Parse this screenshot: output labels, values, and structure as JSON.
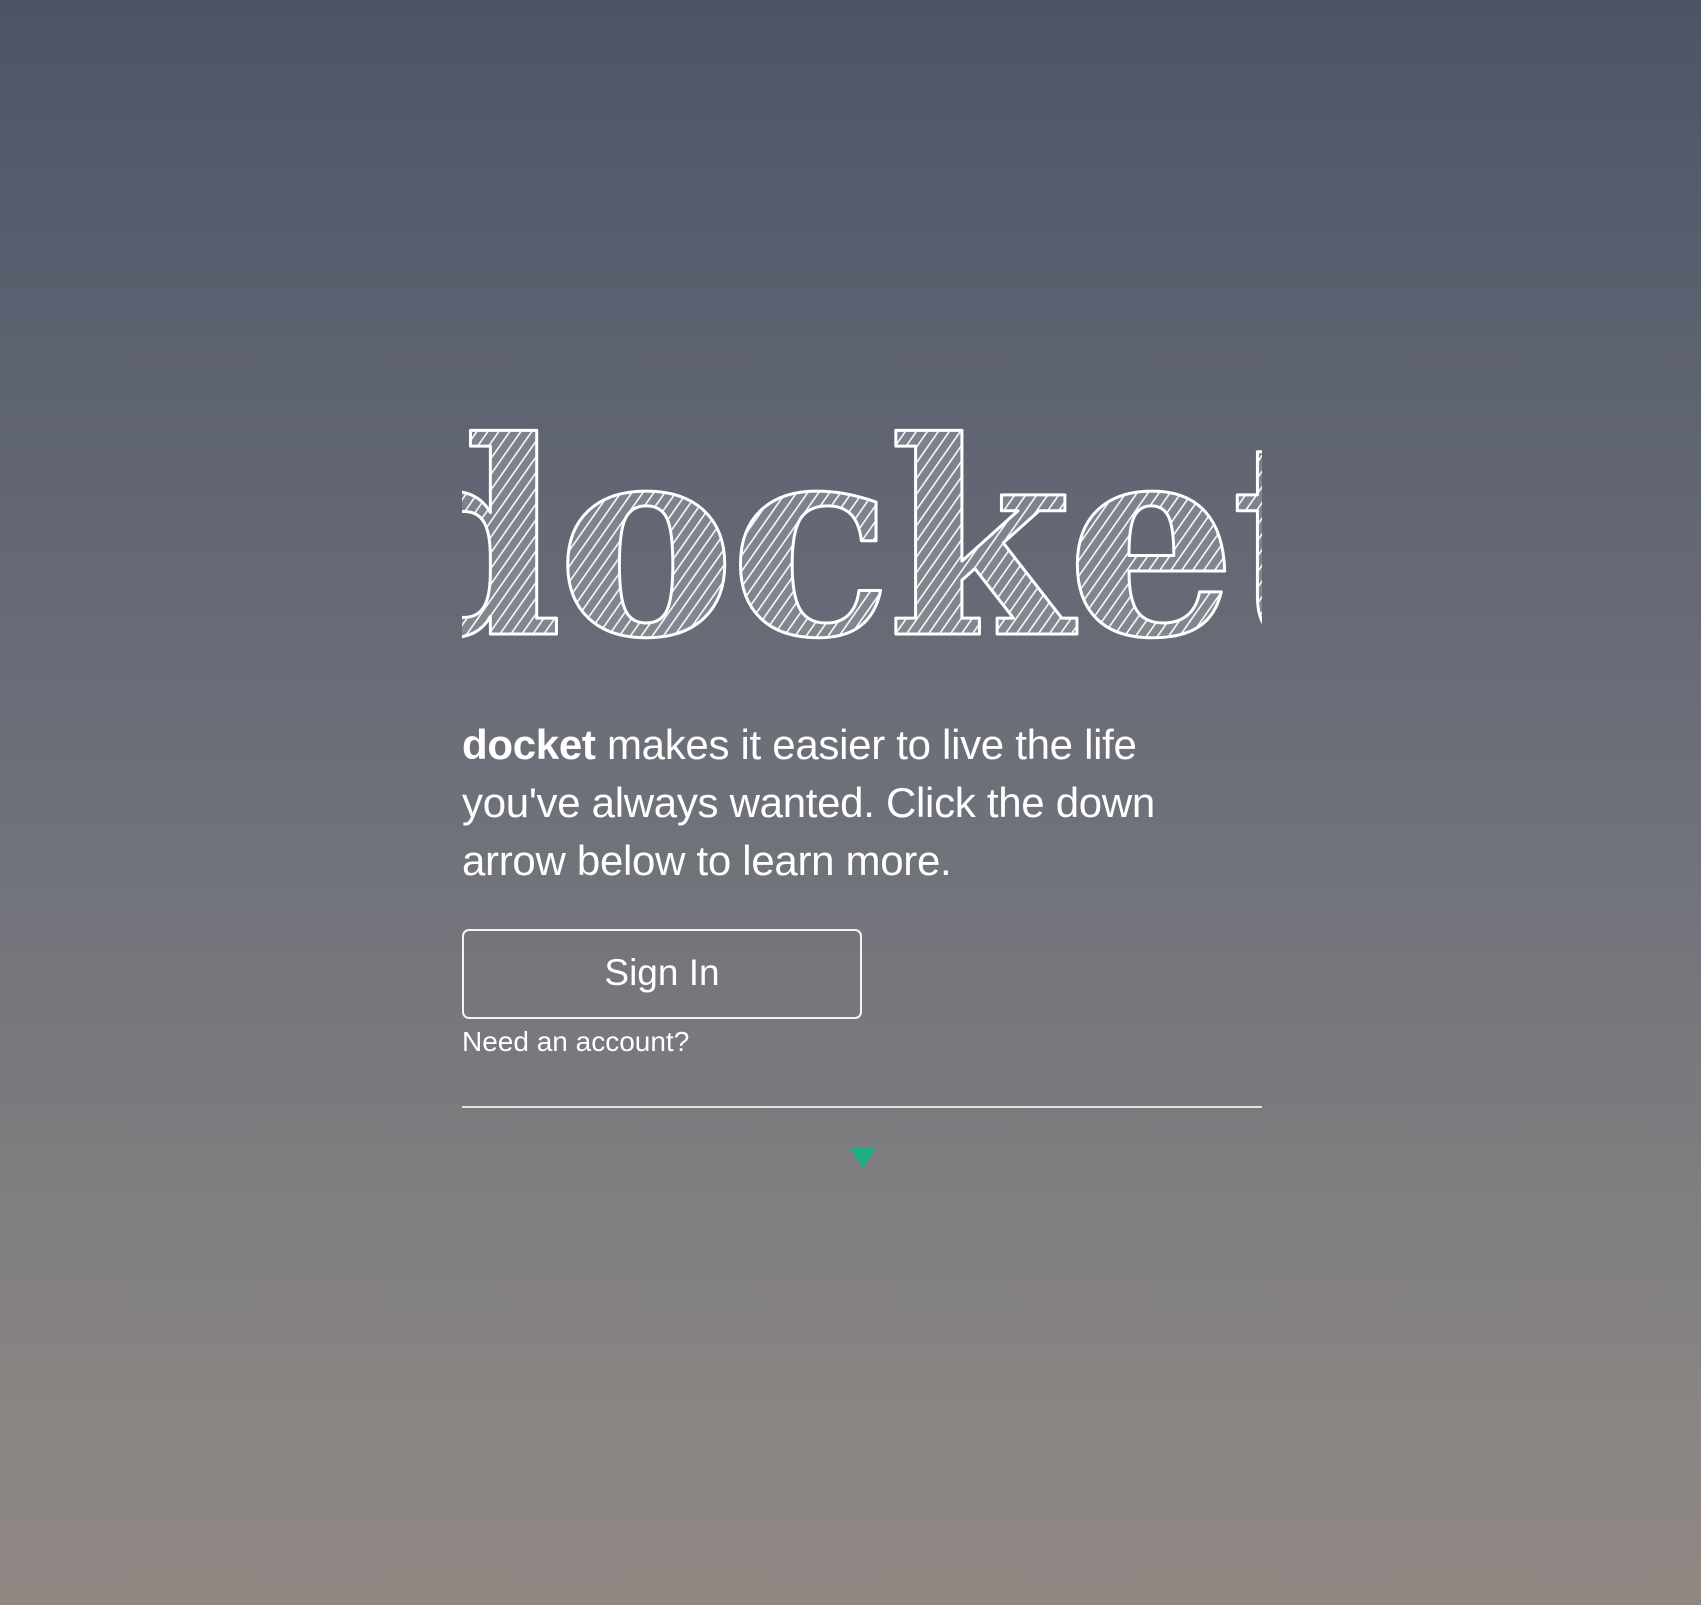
{
  "brand": {
    "logo_text": "docket",
    "name": "docket"
  },
  "hero": {
    "tagline_rest": " makes it easier to live the life you've always wanted. Click the down arrow below to learn more."
  },
  "actions": {
    "signin_label": "Sign In",
    "signup_link": "Need an account?"
  },
  "icons": {
    "scroll": "triangle-down-icon"
  },
  "colors": {
    "accent": "#1fae83",
    "text": "#ffffff",
    "background_top": "#4d5464",
    "background_bottom": "#8f8782"
  }
}
